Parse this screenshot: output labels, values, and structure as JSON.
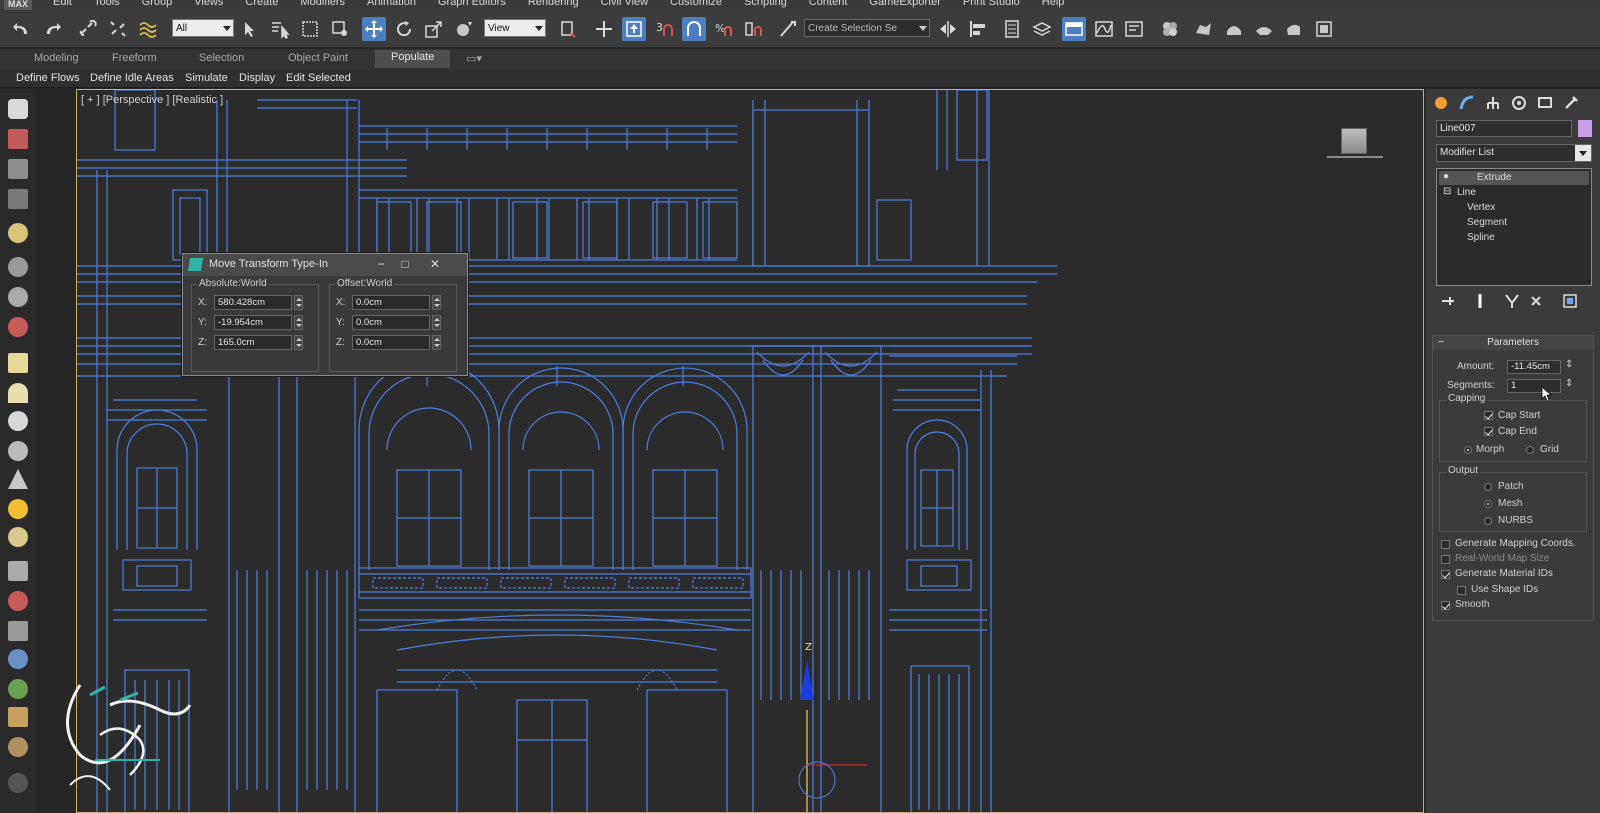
{
  "menubar": {
    "logo": "MAX",
    "items": [
      "Edit",
      "Tools",
      "Group",
      "Views",
      "Create",
      "Modifiers",
      "Animation",
      "Graph Editors",
      "Rendering",
      "Civil View",
      "Customize",
      "Scripting",
      "Content",
      "GameExporter",
      "Print Studio",
      "Help"
    ]
  },
  "toolbar": {
    "selection_filter": "All",
    "reference_coord": "View",
    "named_selection": "Create Selection Se"
  },
  "ribbon": {
    "tabs": [
      "Modeling",
      "Freeform",
      "Selection",
      "Object Paint",
      "Populate"
    ],
    "selected_tab": "Populate",
    "sub_items": [
      "Define Flows",
      "Define Idle Areas",
      "Simulate",
      "Display",
      "Edit Selected"
    ]
  },
  "viewport": {
    "label": "[ + ] [Perspective ] [Realistic ]",
    "axis_label": "Z"
  },
  "dialog": {
    "title": "Move Transform Type-In",
    "absolute": {
      "label": "Absolute:World",
      "x_label": "X:",
      "x": "580.428cm",
      "y_label": "Y:",
      "y": "-19.954cm",
      "z_label": "Z:",
      "z": "165.0cm"
    },
    "offset": {
      "label": "Offset:World",
      "x_label": "X:",
      "x": "0.0cm",
      "y_label": "Y:",
      "y": "0.0cm",
      "z_label": "Z:",
      "z": "0.0cm"
    }
  },
  "command_panel": {
    "object_name": "Line007",
    "object_color": "#c79ee8",
    "modifier_list": "Modifier List",
    "stack": {
      "modifier": "Extrude",
      "base": "Line",
      "sub": [
        "Vertex",
        "Segment",
        "Spline"
      ]
    },
    "parameters": {
      "title": "Parameters",
      "collapse": "−",
      "amount_label": "Amount:",
      "amount": "-11.45cm",
      "segments_label": "Segments:",
      "segments": "1",
      "capping_label": "Capping",
      "cap_start": "Cap Start",
      "cap_end": "Cap End",
      "morph": "Morph",
      "grid": "Grid",
      "output_label": "Output",
      "patch": "Patch",
      "mesh": "Mesh",
      "nurbs": "NURBS",
      "gen_mapping": "Generate Mapping Coords.",
      "real_world": "Real-World Map Size",
      "gen_material": "Generate Material IDs",
      "use_shape": "Use Shape IDs",
      "smooth": "Smooth"
    }
  },
  "colors": {
    "wireframe": "#4f7fe0",
    "active_button": "#4b7fc0",
    "viewport_border": "#c9b46a",
    "gizmo_z": "#1b3de0"
  }
}
